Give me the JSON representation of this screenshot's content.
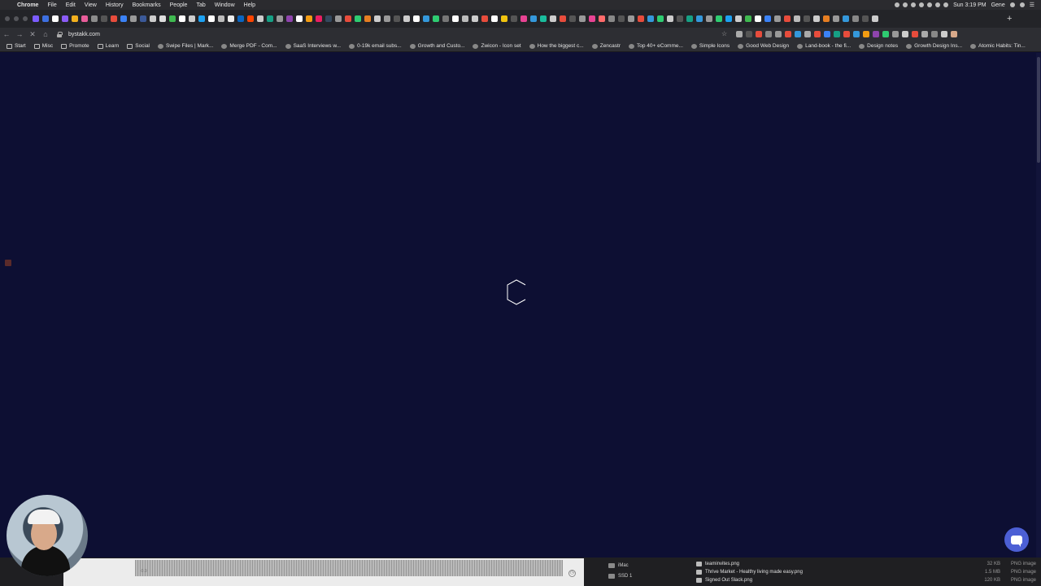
{
  "menubar": {
    "app": "Chrome",
    "items": [
      "File",
      "Edit",
      "View",
      "History",
      "Bookmarks",
      "People",
      "Tab",
      "Window",
      "Help"
    ],
    "clock": "Sun 3:19 PM",
    "user": "Gene"
  },
  "address_bar": {
    "url": "bystakk.com"
  },
  "bookmarks": [
    {
      "label": "Start",
      "type": "folder"
    },
    {
      "label": "Misc",
      "type": "folder"
    },
    {
      "label": "Promote",
      "type": "folder"
    },
    {
      "label": "Learn",
      "type": "folder"
    },
    {
      "label": "Social",
      "type": "folder"
    },
    {
      "label": "Swipe Files | Mark...",
      "type": "site"
    },
    {
      "label": "Merge PDF - Com...",
      "type": "site"
    },
    {
      "label": "SaaS Interviews w...",
      "type": "site"
    },
    {
      "label": "0-19k email subs...",
      "type": "site"
    },
    {
      "label": "Growth and Custo...",
      "type": "site"
    },
    {
      "label": "Zwicon - Icon set",
      "type": "site"
    },
    {
      "label": "How the biggest c...",
      "type": "site"
    },
    {
      "label": "Zencastr",
      "type": "site"
    },
    {
      "label": "Top 40+ eComme...",
      "type": "site"
    },
    {
      "label": "Simple Icons",
      "type": "site"
    },
    {
      "label": "Good Web Design",
      "type": "site"
    },
    {
      "label": "Land-book - the fi...",
      "type": "site"
    },
    {
      "label": "Design notes",
      "type": "site"
    },
    {
      "label": "Growth Design Ins...",
      "type": "site"
    },
    {
      "label": "Atomic Habits: Tin...",
      "type": "site"
    }
  ],
  "colors": {
    "page_bg": "#0d0f33",
    "chat_accent": "#4c5fd5"
  },
  "finder": {
    "locations": [
      "iMac",
      "SSD 1"
    ],
    "files": [
      {
        "name": "teaminvites.png",
        "size": "32 KB",
        "kind": "PNG image"
      },
      {
        "name": "Thrive Market - Healthy living made easy.png",
        "size": "1.5 MB",
        "kind": "PNG image"
      },
      {
        "name": "Signed Out  Slack.png",
        "size": "120 KB",
        "kind": "PNG image"
      }
    ]
  },
  "audio": {
    "time_label": "-0.9"
  }
}
